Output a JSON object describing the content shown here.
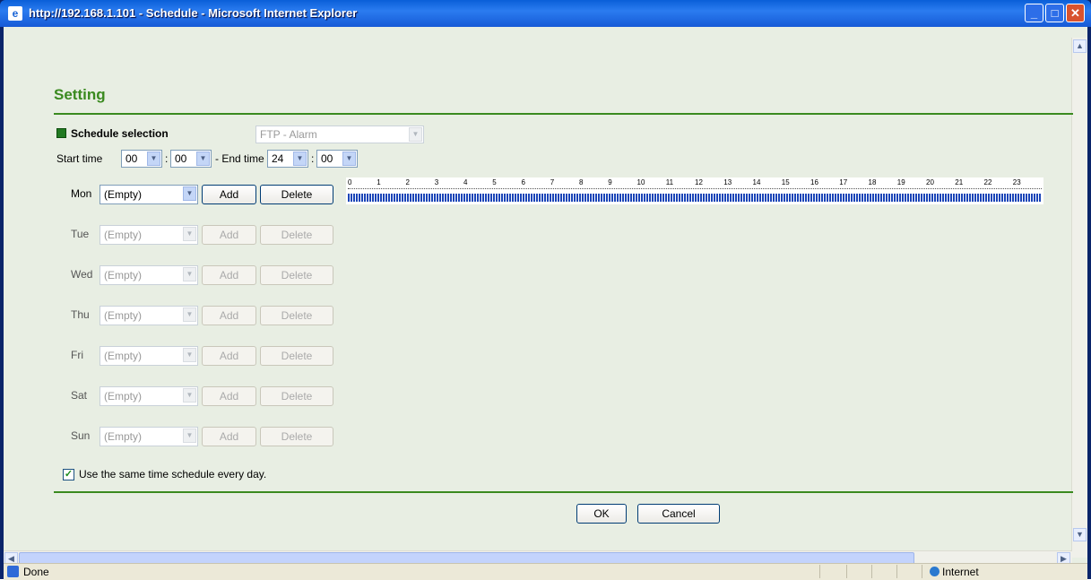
{
  "window": {
    "title": "http://192.168.1.101 - Schedule - Microsoft Internet Explorer"
  },
  "page": {
    "heading": "Setting",
    "schedule_selection_label": "Schedule selection",
    "schedule_selection_value": "FTP - Alarm",
    "start_time_label": "Start time",
    "start_hour": "00",
    "start_min": "00",
    "end_time_label": "- End time",
    "end_hour": "24",
    "end_min": "00",
    "colon": ":",
    "days": [
      {
        "label": "Mon",
        "value": "(Empty)",
        "add": "Add",
        "delete": "Delete"
      },
      {
        "label": "Tue",
        "value": "(Empty)",
        "add": "Add",
        "delete": "Delete"
      },
      {
        "label": "Wed",
        "value": "(Empty)",
        "add": "Add",
        "delete": "Delete"
      },
      {
        "label": "Thu",
        "value": "(Empty)",
        "add": "Add",
        "delete": "Delete"
      },
      {
        "label": "Fri",
        "value": "(Empty)",
        "add": "Add",
        "delete": "Delete"
      },
      {
        "label": "Sat",
        "value": "(Empty)",
        "add": "Add",
        "delete": "Delete"
      },
      {
        "label": "Sun",
        "value": "(Empty)",
        "add": "Add",
        "delete": "Delete"
      }
    ],
    "timeline_hours": [
      "0",
      "1",
      "2",
      "3",
      "4",
      "5",
      "6",
      "7",
      "8",
      "9",
      "10",
      "11",
      "12",
      "13",
      "14",
      "15",
      "16",
      "17",
      "18",
      "19",
      "20",
      "21",
      "22",
      "23"
    ],
    "same_schedule_label": "Use the same time schedule every day.",
    "same_schedule_checked": true,
    "ok": "OK",
    "cancel": "Cancel"
  },
  "statusbar": {
    "status": "Done",
    "zone": "Internet"
  },
  "colors": {
    "accent": "#3a8a1f",
    "timeline": "#1a45b8"
  }
}
